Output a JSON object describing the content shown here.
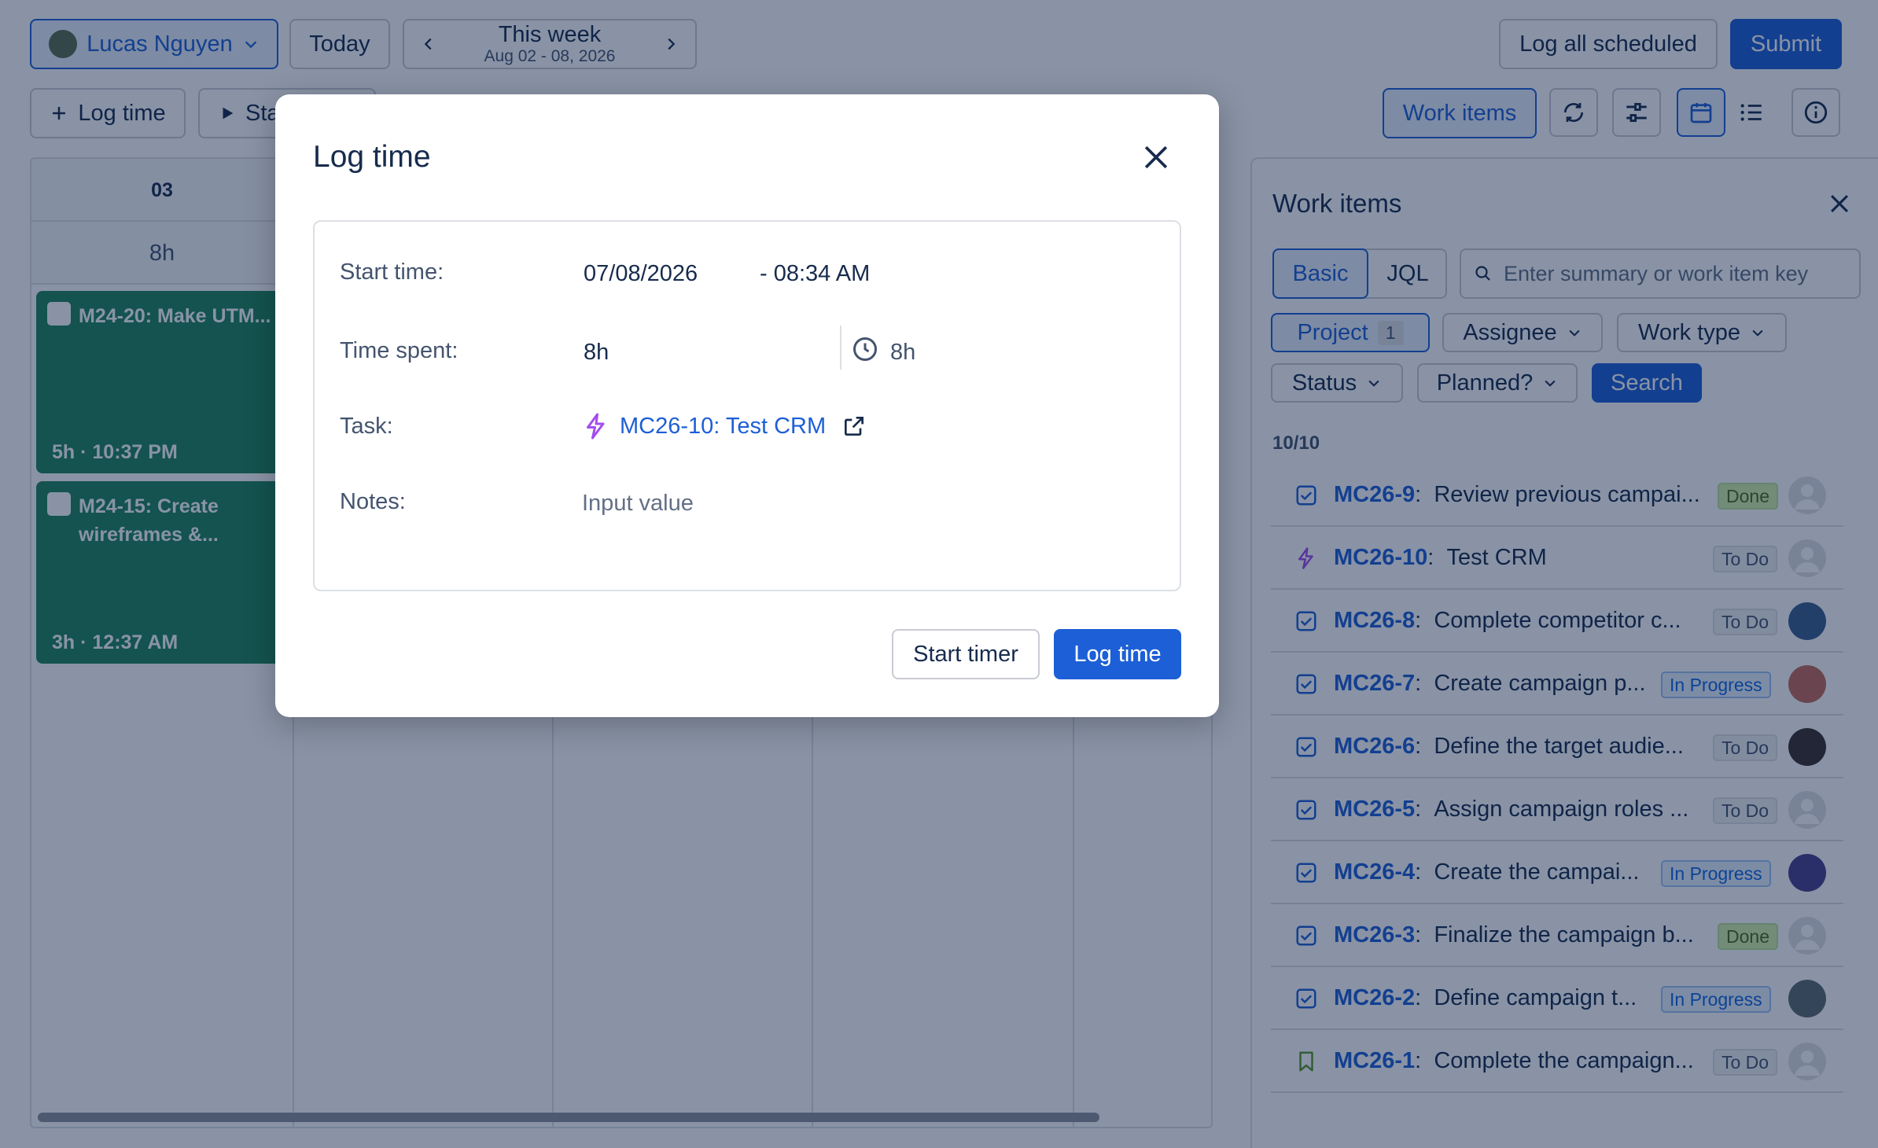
{
  "header": {
    "user_name": "Lucas Nguyen",
    "today_label": "Today",
    "week_title": "This week",
    "week_range": "Aug 02 - 08, 2026",
    "log_all_label": "Log all scheduled",
    "submit_label": "Submit"
  },
  "toolbar": {
    "log_time_label": "Log time",
    "start_timer_label": "Sta",
    "work_items_label": "Work items"
  },
  "calendar": {
    "day_number": "03",
    "day_hours": "8h",
    "events": [
      {
        "title": "M24-20: Make UTM...",
        "footer": "5h · 10:37 PM"
      },
      {
        "title": "M24-15: Create wireframes &...",
        "footer": "3h · 12:37 AM"
      }
    ]
  },
  "panel": {
    "title": "Work items",
    "tab_basic": "Basic",
    "tab_jql": "JQL",
    "search_placeholder": "Enter summary or work item key",
    "filter_project": "Project",
    "filter_project_count": "1",
    "filter_assignee": "Assignee",
    "filter_work_type": "Work type",
    "filter_status": "Status",
    "filter_planned": "Planned?",
    "search_label": "Search",
    "result_count": "10/10",
    "items": [
      {
        "key": "MC26-9",
        "summary": "Review previous campai...",
        "status": "Done",
        "type": "task",
        "avatar": "placeholder"
      },
      {
        "key": "MC26-10",
        "summary": "Test CRM",
        "status": "To Do",
        "type": "epic",
        "avatar": "placeholder"
      },
      {
        "key": "MC26-8",
        "summary": "Complete competitor c...",
        "status": "To Do",
        "type": "task",
        "avatar": "photo-man-blue"
      },
      {
        "key": "MC26-7",
        "summary": "Create campaign p...",
        "status": "In Progress",
        "type": "task",
        "avatar": "photo-woman-red"
      },
      {
        "key": "MC26-6",
        "summary": "Define the target audie...",
        "status": "To Do",
        "type": "task",
        "avatar": "photo-woman-dark"
      },
      {
        "key": "MC26-5",
        "summary": "Assign campaign roles ...",
        "status": "To Do",
        "type": "task",
        "avatar": "placeholder"
      },
      {
        "key": "MC26-4",
        "summary": "Create the campai...",
        "status": "In Progress",
        "type": "task",
        "avatar": "photo-man-glasses"
      },
      {
        "key": "MC26-3",
        "summary": "Finalize the campaign b...",
        "status": "Done",
        "type": "task",
        "avatar": "placeholder"
      },
      {
        "key": "MC26-2",
        "summary": "Define campaign t...",
        "status": "In Progress",
        "type": "task",
        "avatar": "photo-man-grey"
      },
      {
        "key": "MC26-1",
        "summary": "Complete the campaign...",
        "status": "To Do",
        "type": "story",
        "avatar": "placeholder"
      }
    ]
  },
  "modal": {
    "title": "Log time",
    "start_time_label": "Start time:",
    "start_date": "07/08/2026",
    "start_clock": "- 08:34 AM",
    "time_spent_label": "Time spent:",
    "time_spent_value": "8h",
    "time_remaining_value": "8h",
    "task_label": "Task:",
    "task_value": "MC26-10: Test CRM",
    "notes_label": "Notes:",
    "notes_placeholder": "Input value",
    "start_timer_label": "Start timer",
    "log_time_label": "Log time"
  },
  "colors": {
    "primary": "#1d5fd6",
    "event_green": "#1f845a",
    "epic_purple": "#a54cf0",
    "overlay": "rgba(9,30,66,0.48)"
  }
}
